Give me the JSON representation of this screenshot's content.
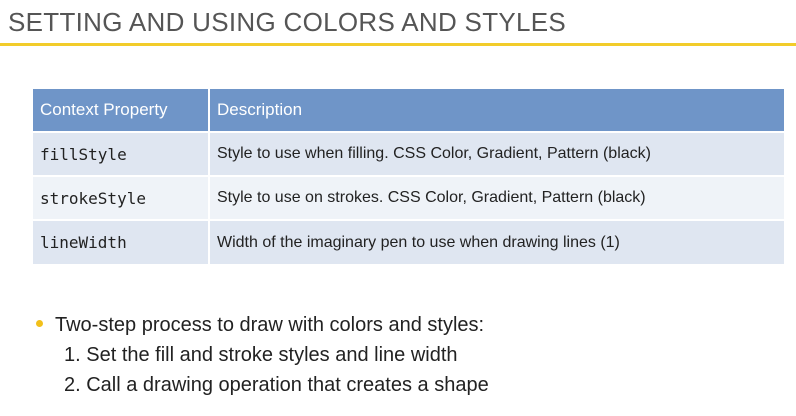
{
  "slide": {
    "title": "SETTING AND USING COLORS AND STYLES",
    "accent_color": "#f2cc2a"
  },
  "table": {
    "header_color": "#6f95c8",
    "headers": {
      "property": "Context Property",
      "description": "Description"
    },
    "rows": [
      {
        "property": "fillStyle",
        "description": "Style to use when filling. CSS Color, Gradient, Pattern (black)"
      },
      {
        "property": "strokeStyle",
        "description": "Style to use on strokes. CSS Color, Gradient, Pattern (black)"
      },
      {
        "property": "lineWidth",
        "description": "Width of the imaginary pen to use when drawing lines (1)"
      }
    ]
  },
  "bullets": {
    "main": "Two-step process to draw with colors and styles:",
    "steps": [
      "1. Set the fill and stroke styles and line width",
      "2. Call a drawing operation that creates a shape"
    ]
  }
}
